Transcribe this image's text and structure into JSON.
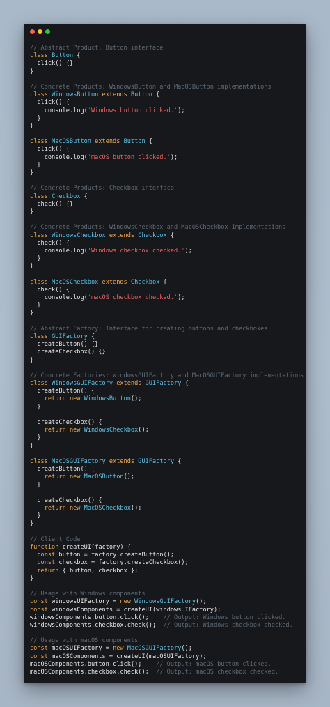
{
  "window": {
    "buttons": [
      "close",
      "minimize",
      "maximize"
    ],
    "colors": {
      "close": "#ff5f56",
      "minimize": "#ffbd2e",
      "maximize": "#27c93f",
      "background": "#16181b"
    }
  },
  "code_lines": [
    "// Abstract Product: Button interface",
    "class Button {",
    "  click() {}",
    "}",
    "",
    "// Concrete Products: WindowsButton and MacOSButton implementations",
    "class WindowsButton extends Button {",
    "  click() {",
    "    console.log('Windows button clicked.');",
    "  }",
    "}",
    "",
    "class MacOSButton extends Button {",
    "  click() {",
    "    console.log('macOS button clicked.');",
    "  }",
    "}",
    "",
    "// Concrete Products: Checkbox interface",
    "class Checkbox {",
    "  check() {}",
    "}",
    "",
    "// Concrete Products: WindowsCheckbox and MacOSCheckbox implementations",
    "class WindowsCheckbox extends Checkbox {",
    "  check() {",
    "    console.log('Windows checkbox checked.');",
    "  }",
    "}",
    "",
    "class MacOSCheckbox extends Checkbox {",
    "  check() {",
    "    console.log('macOS checkbox checked.');",
    "  }",
    "}",
    "",
    "// Abstract Factory: Interface for creating buttons and checkboxes",
    "class GUIFactory {",
    "  createButton() {}",
    "  createCheckbox() {}",
    "}",
    "",
    "// Concrete Factories: WindowsGUIFactory and MacOSGUIFactory implementations",
    "class WindowsGUIFactory extends GUIFactory {",
    "  createButton() {",
    "    return new WindowsButton();",
    "  }",
    "",
    "  createCheckbox() {",
    "    return new WindowsCheckbox();",
    "  }",
    "}",
    "",
    "class MacOSGUIFactory extends GUIFactory {",
    "  createButton() {",
    "    return new MacOSButton();",
    "  }",
    "",
    "  createCheckbox() {",
    "    return new MacOSCheckbox();",
    "  }",
    "}",
    "",
    "// Client Code",
    "function createUI(factory) {",
    "  const button = factory.createButton();",
    "  const checkbox = factory.createCheckbox();",
    "  return { button, checkbox };",
    "}",
    "",
    "// Usage with Windows components",
    "const windowsUIFactory = new WindowsGUIFactory();",
    "const windowsComponents = createUI(windowsUIFactory);",
    "windowsComponents.button.click();    // Output: Windows button clicked.",
    "windowsComponents.checkbox.check();  // Output: Windows checkbox checked.",
    "",
    "// Usage with macOS components",
    "const macOSUIFactory = new MacOSGUIFactory();",
    "const macOSComponents = createUI(macOSUIFactory);",
    "macOSComponents.button.click();    // Output: macOS button clicked.",
    "macOSComponents.checkbox.check();  // Output: macOS checkbox checked."
  ]
}
